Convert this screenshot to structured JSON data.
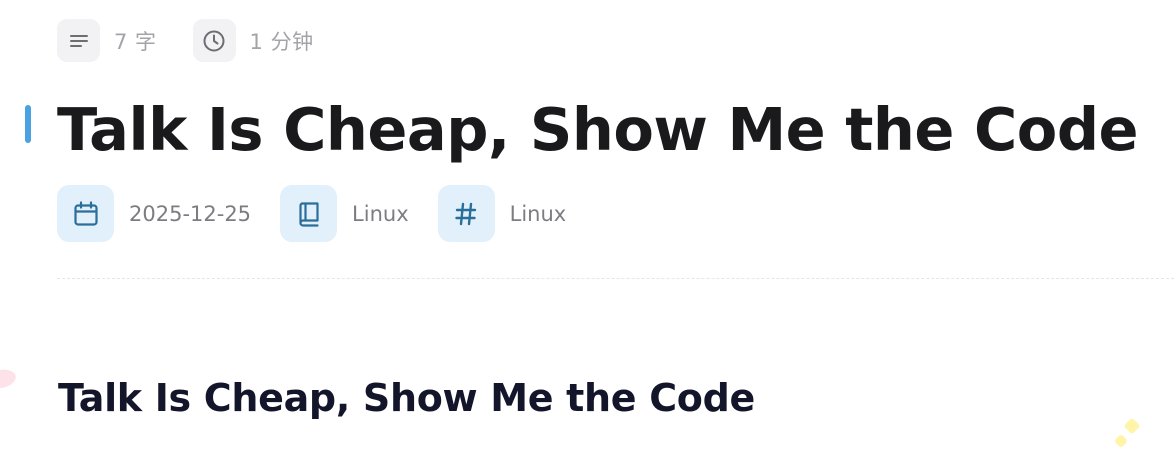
{
  "meta_top": {
    "word_count": "7 字",
    "read_time": "1 分钟",
    "icons": {
      "word_count": "text-lines-icon",
      "read_time": "clock-icon"
    }
  },
  "post": {
    "title": "Talk Is Cheap, Show Me the Code",
    "date": "2025-12-25",
    "category": "Linux",
    "tag": "Linux",
    "icons": {
      "date": "calendar-icon",
      "category": "book-icon",
      "tag": "hash-icon"
    }
  },
  "content": {
    "heading": "Talk Is Cheap, Show Me the Code"
  },
  "colors": {
    "accent": "#4aa3e0",
    "meta_icon": "#2a6f99",
    "meta_icon_bg": "#e1f0fb",
    "title": "#1a1a1d"
  }
}
